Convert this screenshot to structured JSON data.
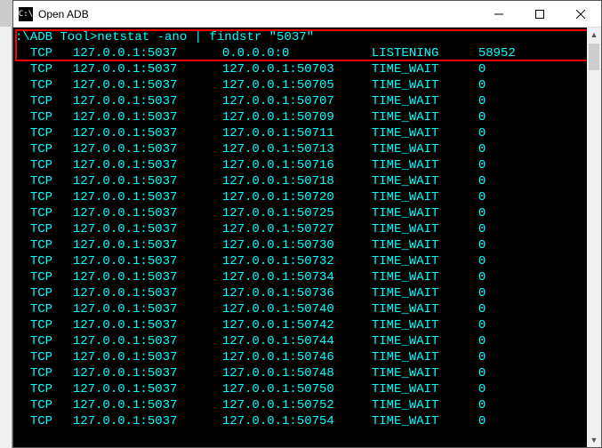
{
  "window": {
    "title": "Open ADB",
    "icon_label": "C:\\"
  },
  "terminal": {
    "prompt_prefix": ":\\ADB Tool>",
    "command": "netstat -ano | findstr \"5037\"",
    "rows": [
      {
        "proto": "TCP",
        "local": "127.0.0.1:5037",
        "foreign": "0.0.0.0:0",
        "state": "LISTENING",
        "pid": "58952"
      },
      {
        "proto": "TCP",
        "local": "127.0.0.1:5037",
        "foreign": "127.0.0.1:50703",
        "state": "TIME_WAIT",
        "pid": "0"
      },
      {
        "proto": "TCP",
        "local": "127.0.0.1:5037",
        "foreign": "127.0.0.1:50705",
        "state": "TIME_WAIT",
        "pid": "0"
      },
      {
        "proto": "TCP",
        "local": "127.0.0.1:5037",
        "foreign": "127.0.0.1:50707",
        "state": "TIME_WAIT",
        "pid": "0"
      },
      {
        "proto": "TCP",
        "local": "127.0.0.1:5037",
        "foreign": "127.0.0.1:50709",
        "state": "TIME_WAIT",
        "pid": "0"
      },
      {
        "proto": "TCP",
        "local": "127.0.0.1:5037",
        "foreign": "127.0.0.1:50711",
        "state": "TIME_WAIT",
        "pid": "0"
      },
      {
        "proto": "TCP",
        "local": "127.0.0.1:5037",
        "foreign": "127.0.0.1:50713",
        "state": "TIME_WAIT",
        "pid": "0"
      },
      {
        "proto": "TCP",
        "local": "127.0.0.1:5037",
        "foreign": "127.0.0.1:50716",
        "state": "TIME_WAIT",
        "pid": "0"
      },
      {
        "proto": "TCP",
        "local": "127.0.0.1:5037",
        "foreign": "127.0.0.1:50718",
        "state": "TIME_WAIT",
        "pid": "0"
      },
      {
        "proto": "TCP",
        "local": "127.0.0.1:5037",
        "foreign": "127.0.0.1:50720",
        "state": "TIME_WAIT",
        "pid": "0"
      },
      {
        "proto": "TCP",
        "local": "127.0.0.1:5037",
        "foreign": "127.0.0.1:50725",
        "state": "TIME_WAIT",
        "pid": "0"
      },
      {
        "proto": "TCP",
        "local": "127.0.0.1:5037",
        "foreign": "127.0.0.1:50727",
        "state": "TIME_WAIT",
        "pid": "0"
      },
      {
        "proto": "TCP",
        "local": "127.0.0.1:5037",
        "foreign": "127.0.0.1:50730",
        "state": "TIME_WAIT",
        "pid": "0"
      },
      {
        "proto": "TCP",
        "local": "127.0.0.1:5037",
        "foreign": "127.0.0.1:50732",
        "state": "TIME_WAIT",
        "pid": "0"
      },
      {
        "proto": "TCP",
        "local": "127.0.0.1:5037",
        "foreign": "127.0.0.1:50734",
        "state": "TIME_WAIT",
        "pid": "0"
      },
      {
        "proto": "TCP",
        "local": "127.0.0.1:5037",
        "foreign": "127.0.0.1:50736",
        "state": "TIME_WAIT",
        "pid": "0"
      },
      {
        "proto": "TCP",
        "local": "127.0.0.1:5037",
        "foreign": "127.0.0.1:50740",
        "state": "TIME_WAIT",
        "pid": "0"
      },
      {
        "proto": "TCP",
        "local": "127.0.0.1:5037",
        "foreign": "127.0.0.1:50742",
        "state": "TIME_WAIT",
        "pid": "0"
      },
      {
        "proto": "TCP",
        "local": "127.0.0.1:5037",
        "foreign": "127.0.0.1:50744",
        "state": "TIME_WAIT",
        "pid": "0"
      },
      {
        "proto": "TCP",
        "local": "127.0.0.1:5037",
        "foreign": "127.0.0.1:50746",
        "state": "TIME_WAIT",
        "pid": "0"
      },
      {
        "proto": "TCP",
        "local": "127.0.0.1:5037",
        "foreign": "127.0.0.1:50748",
        "state": "TIME_WAIT",
        "pid": "0"
      },
      {
        "proto": "TCP",
        "local": "127.0.0.1:5037",
        "foreign": "127.0.0.1:50750",
        "state": "TIME_WAIT",
        "pid": "0"
      },
      {
        "proto": "TCP",
        "local": "127.0.0.1:5037",
        "foreign": "127.0.0.1:50752",
        "state": "TIME_WAIT",
        "pid": "0"
      },
      {
        "proto": "TCP",
        "local": "127.0.0.1:5037",
        "foreign": "127.0.0.1:50754",
        "state": "TIME_WAIT",
        "pid": "0"
      }
    ]
  }
}
